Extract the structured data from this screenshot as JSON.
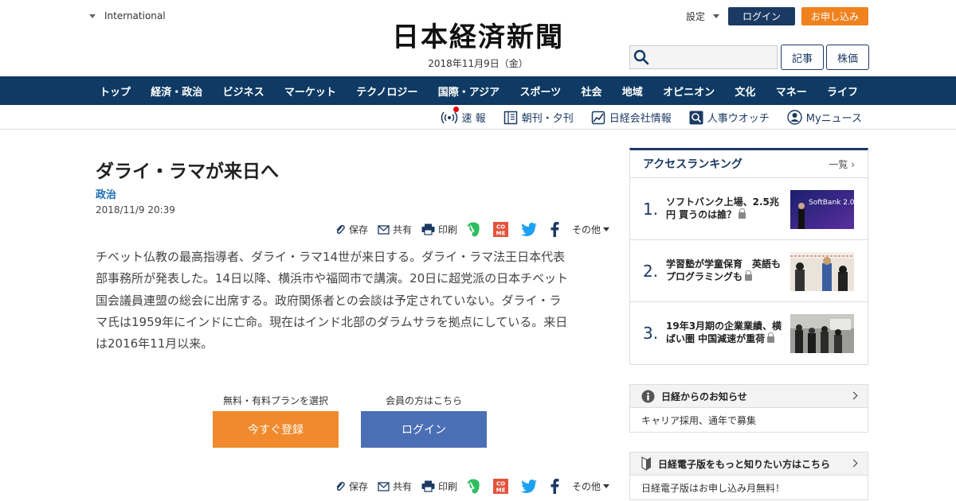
{
  "header": {
    "region_label": "International",
    "logo_text": "日本経済新聞",
    "date": "2018年11月9日（金）",
    "settings_label": "設定",
    "login_label": "ログイン",
    "apply_label": "お申し込み",
    "search_placeholder": "",
    "articles_button": "記事",
    "stocks_button": "株価"
  },
  "main_nav": [
    "トップ",
    "経済・政治",
    "ビジネス",
    "マーケット",
    "テクノロジー",
    "国際・アジア",
    "スポーツ",
    "社会",
    "地域",
    "オピニオン",
    "文化",
    "マネー",
    "ライフ"
  ],
  "sub_nav": [
    {
      "label": "速 報",
      "icon": "radio-wave-icon"
    },
    {
      "label": "朝刊・夕刊",
      "icon": "newspaper-icon"
    },
    {
      "label": "日経会社情報",
      "icon": "chart-icon"
    },
    {
      "label": "人事ウオッチ",
      "icon": "magnifier-icon"
    },
    {
      "label": "Myニュース",
      "icon": "user-icon"
    }
  ],
  "article": {
    "headline": "ダライ・ラマが来日へ",
    "category": "政治",
    "published": "2018/11/9 20:39",
    "body_lines": [
      "チベット仏教の最高指導者、ダライ・ラマ14世が来日する。ダライ・ラマ法王日本代表",
      "部事務所が発表した。14日以降、横浜市や福岡市で講演。20日に超党派の日本チベット",
      "国会議員連盟の総会に出席する。政府関係者との会談は予定されていない。ダライ・ラ",
      "マ氏は1959年にインドに亡命。現在はインド北部のダラムサラを拠点にしている。来日",
      "は2016年11月以来。"
    ]
  },
  "share": {
    "save": "保存",
    "share": "共有",
    "print": "印刷",
    "come_label": "CO ME",
    "more": "その他"
  },
  "cta": {
    "register_caption": "無料・有料プランを選択",
    "register_button": "今すぐ登録",
    "member_caption": "会員の方はこちら",
    "login_button": "ログイン"
  },
  "ranking": {
    "title": "アクセスランキング",
    "all_link": "一覧",
    "items": [
      {
        "rank": "1.",
        "title": "ソフトバンク上場、2.5兆円 買うのは誰？",
        "thumb_text": "SoftBank 2.0"
      },
      {
        "rank": "2.",
        "title": "学習塾が学童保育　英語もプログラミングも",
        "thumb_text": ""
      },
      {
        "rank": "3.",
        "title": "19年3月期の企業業績、横ばい圏 中国減速が重荷",
        "thumb_text": ""
      }
    ]
  },
  "notice_box": {
    "title": "日経からのお知らせ",
    "body": "キャリア採用、通年で募集"
  },
  "digital_box": {
    "title": "日経電子版をもっと知りたい方はこちら",
    "body": "日経電子版はお申し込み月無料！"
  },
  "colors": {
    "navy": "#0e3a63",
    "orange": "#f0821e",
    "cta_blue": "#4a6fb5",
    "link_blue": "#1a6db3"
  }
}
